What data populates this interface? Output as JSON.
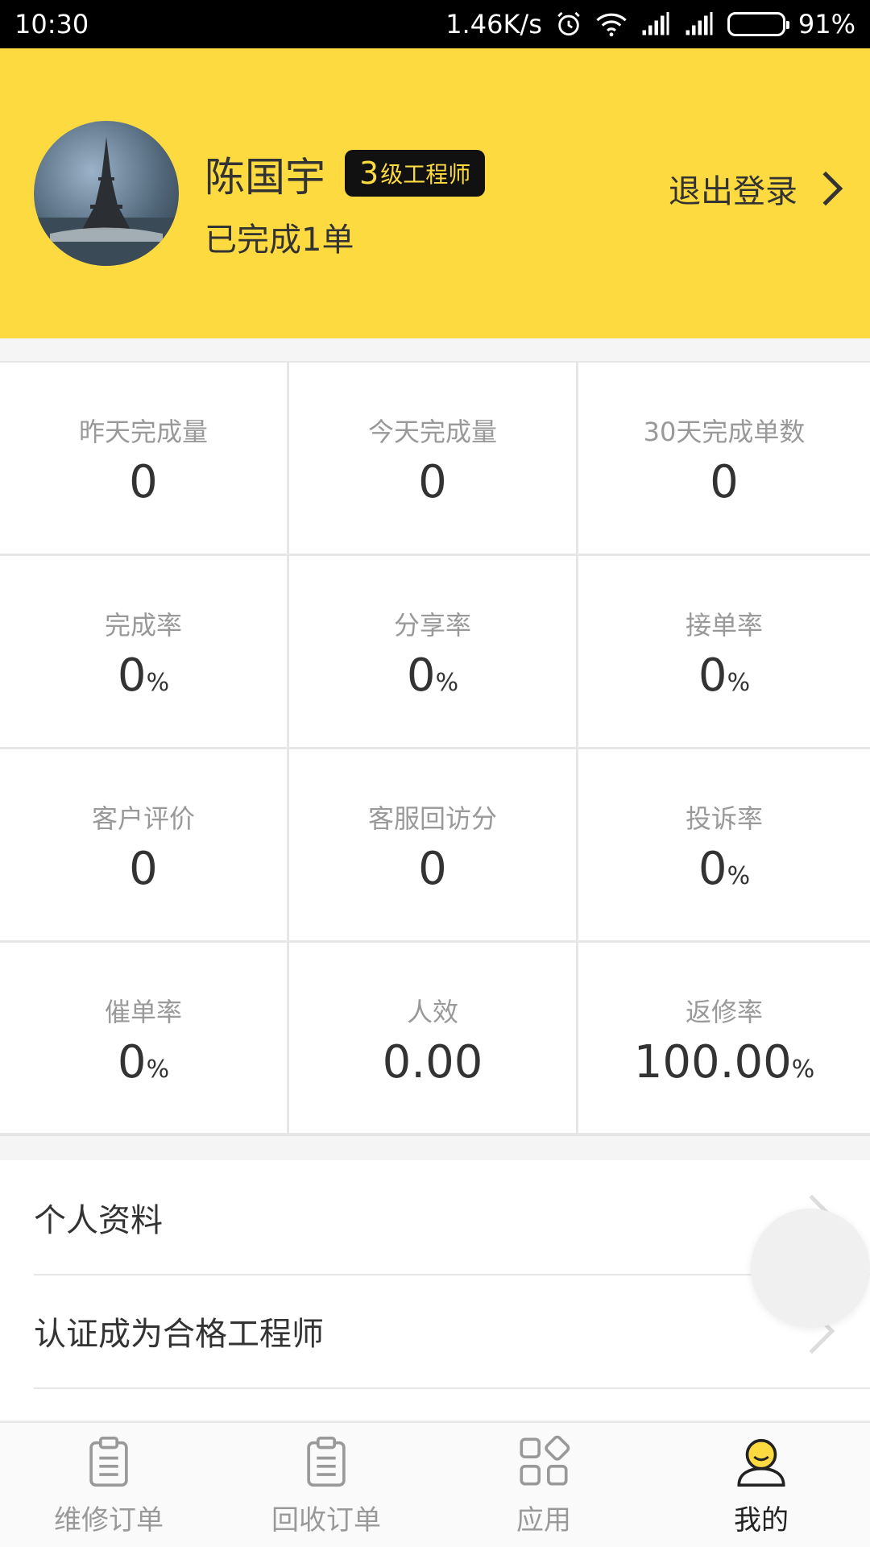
{
  "status_bar": {
    "time": "10:30",
    "network_speed": "1.46K/s",
    "battery": "91%",
    "icons": [
      "alarm-icon",
      "wifi-icon",
      "signal-icon",
      "signal-icon",
      "battery-icon"
    ]
  },
  "profile": {
    "name": "陈国宇",
    "level_number": "3",
    "level_title": "级工程师",
    "completed": "已完成1单",
    "logout_label": "退出登录",
    "accent_color": "#fddb40"
  },
  "stats": [
    {
      "label": "昨天完成量",
      "value": "0",
      "unit": ""
    },
    {
      "label": "今天完成量",
      "value": "0",
      "unit": ""
    },
    {
      "label": "30天完成单数",
      "value": "0",
      "unit": ""
    },
    {
      "label": "完成率",
      "value": "0",
      "unit": "%"
    },
    {
      "label": "分享率",
      "value": "0",
      "unit": "%"
    },
    {
      "label": "接单率",
      "value": "0",
      "unit": "%"
    },
    {
      "label": "客户评价",
      "value": "0",
      "unit": ""
    },
    {
      "label": "客服回访分",
      "value": "0",
      "unit": ""
    },
    {
      "label": "投诉率",
      "value": "0",
      "unit": "%"
    },
    {
      "label": "催单率",
      "value": "0",
      "unit": "%"
    },
    {
      "label": "人效",
      "value": "0.00",
      "unit": ""
    },
    {
      "label": "返修率",
      "value": "100.00",
      "unit": "%"
    }
  ],
  "menu": [
    {
      "label": "个人资料"
    },
    {
      "label": "认证成为合格工程师"
    }
  ],
  "bottom_nav": [
    {
      "label": "维修订单",
      "icon": "clipboard-icon",
      "active": false
    },
    {
      "label": "回收订单",
      "icon": "clipboard-icon",
      "active": false
    },
    {
      "label": "应用",
      "icon": "apps-grid-icon",
      "active": false
    },
    {
      "label": "我的",
      "icon": "user-icon",
      "active": true
    }
  ]
}
